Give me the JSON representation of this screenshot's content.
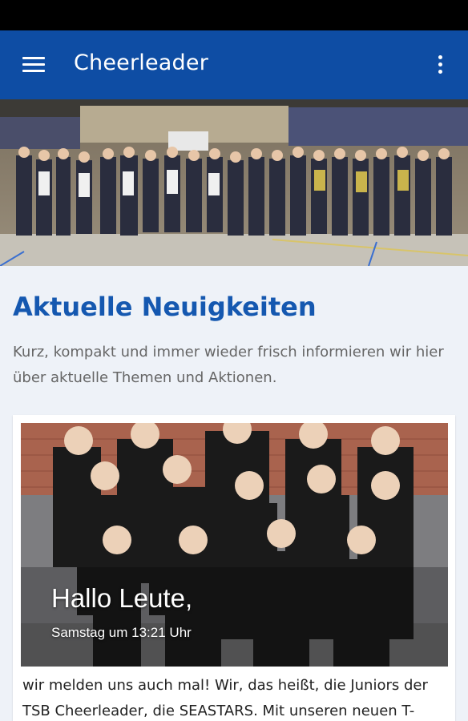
{
  "app_bar": {
    "title": "Cheerleader",
    "menu_icon": "hamburger-menu-icon",
    "overflow_icon": "more-vert-icon",
    "color": "#0e4da4"
  },
  "news_section": {
    "heading": "Aktuelle Neuigkeiten",
    "description": "Kurz, kompakt und immer wieder frisch informieren wir hier über aktuelle Themen und Aktionen.",
    "heading_color": "#1558b0"
  },
  "news_card": {
    "title": "Hallo Leute,",
    "date": "Samstag um 13:21 Uhr",
    "excerpt": "wir melden uns auch mal! Wir, das heißt, die Juniors der TSB Cheerleader, die SEASTARS. Mit unseren neuen T-"
  }
}
